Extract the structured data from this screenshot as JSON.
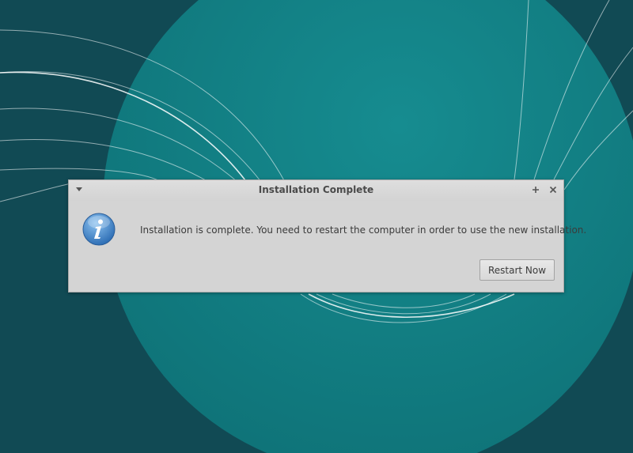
{
  "dialog": {
    "title": "Installation Complete",
    "message": "Installation is complete. You need to restart the computer in order to use the new installation.",
    "restart_label": "Restart Now",
    "icons": {
      "menu": "chevron-down-icon",
      "maximize": "plus-icon",
      "close": "close-icon",
      "info": "info-icon"
    }
  },
  "colors": {
    "desktop_background": "#114a54",
    "wallpaper_circle": "#14868a",
    "dialog_background": "#d4d4d4",
    "info_icon": "#3d86c9"
  }
}
